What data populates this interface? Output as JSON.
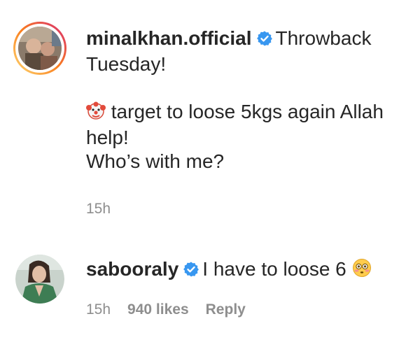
{
  "comments": [
    {
      "username": "minalkhan.official",
      "verified": true,
      "text_first": "Throwback",
      "lines": [
        "Tuesday!",
        "",
        "target to loose 5kgs again Allah",
        "help!",
        "Who’s with me?"
      ],
      "leading_emoji_icon": "clown-face-icon",
      "time": "15h"
    },
    {
      "username": "sabooraly",
      "verified": true,
      "text": "I have to loose 6",
      "trailing_emoji_icon": "flushed-face-icon",
      "time": "15h",
      "likes": "940 likes",
      "reply_label": "Reply"
    }
  ],
  "colors": {
    "text": "#262626",
    "muted": "#8e8e8e",
    "verified_blue": "#3897f0",
    "story_ring_start": "#feda75",
    "story_ring_end": "#d62976"
  }
}
